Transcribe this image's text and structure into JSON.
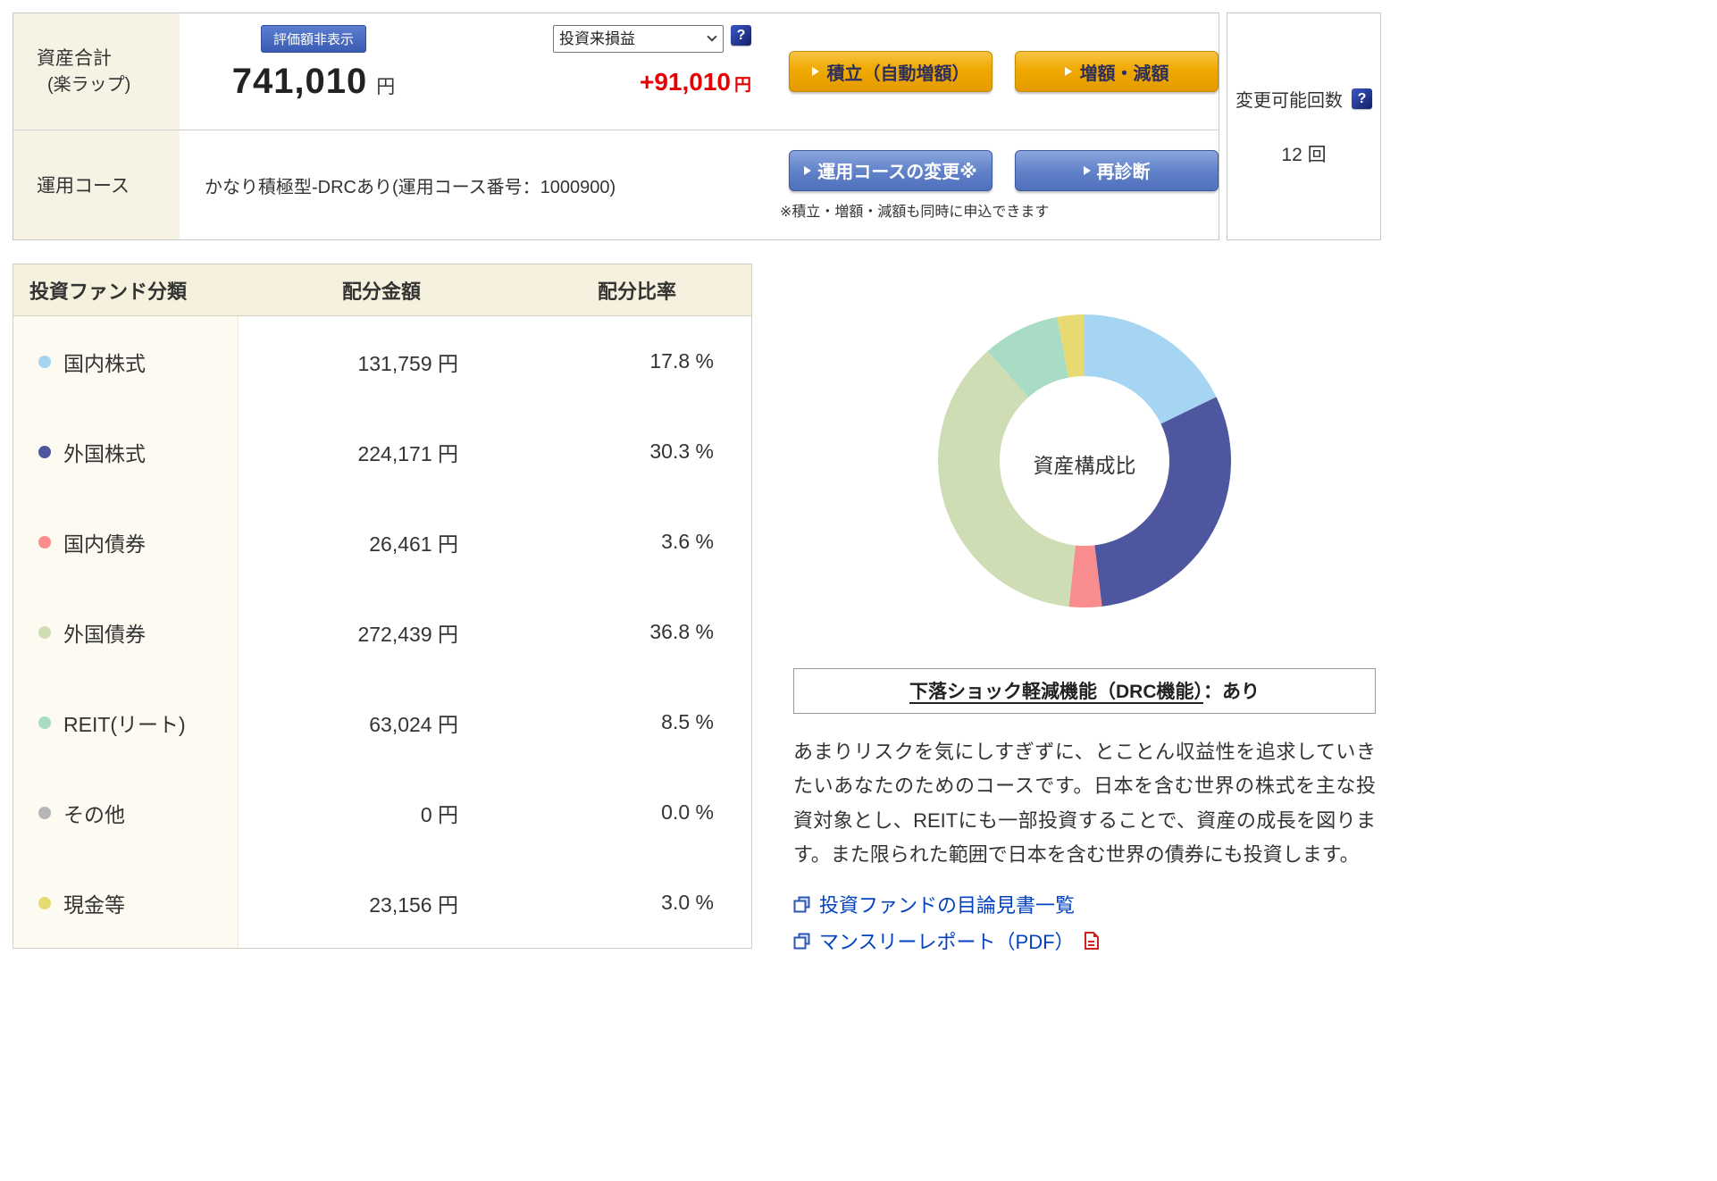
{
  "header": {
    "asset_total_label": "資産合計",
    "asset_total_sublabel": "(楽ラップ)",
    "hide_valuation_button": "評価額非表示",
    "total_amount": "741,010",
    "total_amount_unit": "円",
    "pl_select_value": "投資来損益",
    "pl_amount": "+91,010",
    "pl_amount_unit": "円",
    "reserve_button": "積立（自動増額）",
    "increase_decrease_button": "増額・減額",
    "course_label": "運用コース",
    "course_value": "かなり積極型-DRCあり(運用コース番号：1000900)",
    "course_change_button": "運用コースの変更※",
    "rediagnose_button": "再診断",
    "apply_note": "※積立・増額・減額も同時に申込できます",
    "change_count_label": "変更可能回数",
    "change_count_value": "12 回"
  },
  "icons": {
    "help": "?"
  },
  "table": {
    "headers": {
      "category": "投資ファンド分類",
      "amount": "配分金額",
      "ratio": "配分比率"
    },
    "rows": [
      {
        "label": "国内株式",
        "color": "#a5d5f2",
        "amount": "131,759 円",
        "ratio": "17.8 %"
      },
      {
        "label": "外国株式",
        "color": "#4d569e",
        "amount": "224,171 円",
        "ratio": "30.3 %"
      },
      {
        "label": "国内債券",
        "color": "#f98d8d",
        "amount": "26,461 円",
        "ratio": "3.6 %"
      },
      {
        "label": "外国債券",
        "color": "#cfddb5",
        "amount": "272,439 円",
        "ratio": "36.8 %"
      },
      {
        "label": "REIT(リート)",
        "color": "#a8dcc5",
        "amount": "63,024 円",
        "ratio": "8.5 %"
      },
      {
        "label": "その他",
        "color": "#b5b5b5",
        "amount": "0 円",
        "ratio": "0.0 %"
      },
      {
        "label": "現金等",
        "color": "#e8da72",
        "amount": "23,156 円",
        "ratio": "3.0 %"
      }
    ]
  },
  "chart_data": {
    "type": "pie",
    "donut": true,
    "center_label": "資産構成比",
    "categories": [
      "国内株式",
      "外国株式",
      "国内債券",
      "外国債券",
      "REIT(リート)",
      "その他",
      "現金等"
    ],
    "values": [
      17.8,
      30.3,
      3.6,
      36.8,
      8.5,
      0.0,
      3.0
    ],
    "colors": [
      "#a5d5f2",
      "#4d569e",
      "#f98d8d",
      "#cfddb5",
      "#a8dcc5",
      "#b5b5b5",
      "#e8da72"
    ],
    "unit": "%",
    "legend_position": "none"
  },
  "drc": {
    "title": "下落ショック軽減機能（DRC機能）",
    "title_suffix": "：あり",
    "description": "あまりリスクを気にしすぎずに、とことん収益性を追求していきたいあなたのためのコースです。日本を含む世界の株式を主な投資対象とし、REITにも一部投資することで、資産の成長を図ります。また限られた範囲で日本を含む世界の債券にも投資します。",
    "links": [
      {
        "label": "投資ファンドの目論見書一覧"
      },
      {
        "label": "マンスリーレポート（PDF）"
      }
    ]
  }
}
